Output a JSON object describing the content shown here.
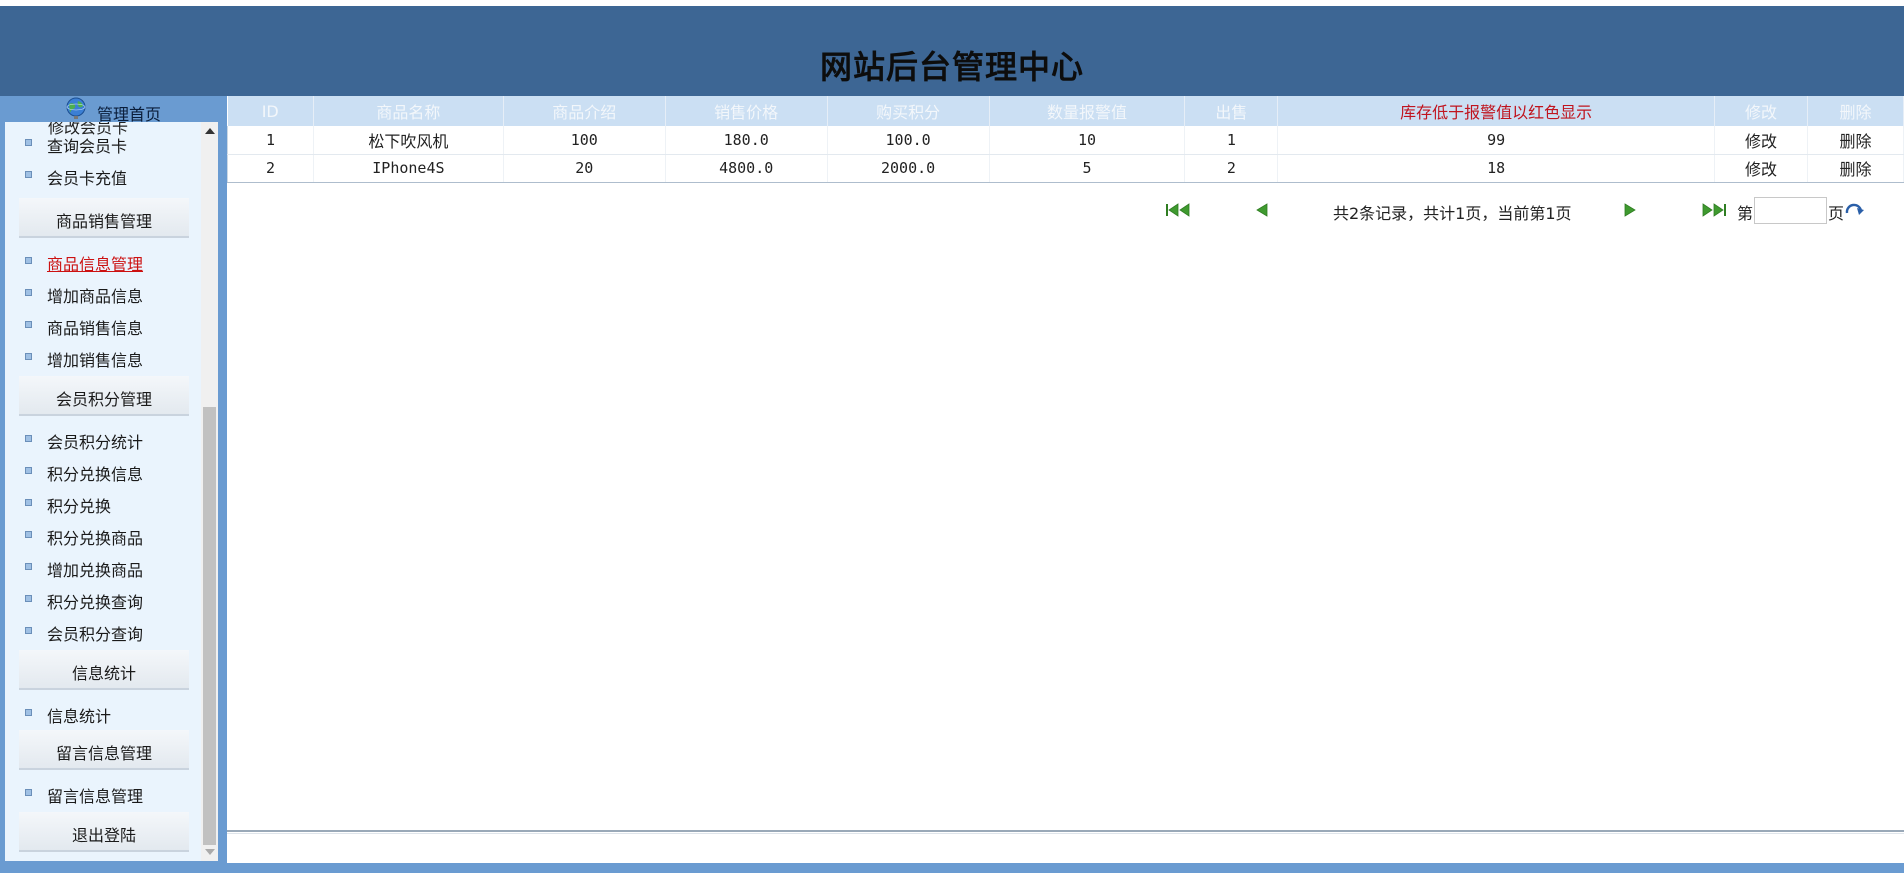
{
  "header": {
    "title": "网站后台管理中心"
  },
  "sidebar": {
    "home_label": "管理首页",
    "clipped_item": "修改会员卡",
    "items_top": [
      {
        "label": "查询会员卡"
      },
      {
        "label": "会员卡充值"
      }
    ],
    "groups": [
      {
        "title": "商品销售管理",
        "items": [
          {
            "label": "商品信息管理",
            "active": true
          },
          {
            "label": "增加商品信息"
          },
          {
            "label": "商品销售信息"
          },
          {
            "label": "增加销售信息"
          }
        ]
      },
      {
        "title": "会员积分管理",
        "items": [
          {
            "label": "会员积分统计"
          },
          {
            "label": "积分兑换信息"
          },
          {
            "label": "积分兑换"
          },
          {
            "label": "积分兑换商品"
          },
          {
            "label": "增加兑换商品"
          },
          {
            "label": "积分兑换查询"
          },
          {
            "label": "会员积分查询"
          }
        ]
      },
      {
        "title": "信息统计",
        "items": [
          {
            "label": "信息统计"
          }
        ]
      },
      {
        "title": "留言信息管理",
        "items": [
          {
            "label": "留言信息管理"
          }
        ]
      },
      {
        "title": "退出登陆",
        "items": []
      }
    ]
  },
  "table": {
    "columns": [
      "ID",
      "商品名称",
      "商品介绍",
      "销售价格",
      "购买积分",
      "数量报警值",
      "出售",
      "库存低于报警值以红色显示",
      "修改",
      "删除"
    ],
    "rows": [
      [
        "1",
        "松下吹风机",
        "100",
        "180.0",
        "100.0",
        "10",
        "1",
        "99",
        "修改",
        "删除"
      ],
      [
        "2",
        "IPhone4S",
        "20",
        "4800.0",
        "2000.0",
        "5",
        "2",
        "18",
        "修改",
        "删除"
      ]
    ]
  },
  "pager": {
    "info": "共2条记录，共计1页，当前第1页",
    "page_prefix": "第",
    "page_suffix": "页",
    "page_input_value": ""
  },
  "colors": {
    "header_bg": "#3d6694",
    "sidebar_bg": "#6a9bd1",
    "table_head_bg": "#cbdff3",
    "alert_red": "#c0141e",
    "pager_arrow_green": "#3f9a2f"
  },
  "icons": {
    "home": "globe-icon",
    "first": "first-page-icon",
    "prev": "prev-page-icon",
    "next": "next-page-icon",
    "last": "last-page-icon",
    "go": "go-refresh-icon"
  }
}
